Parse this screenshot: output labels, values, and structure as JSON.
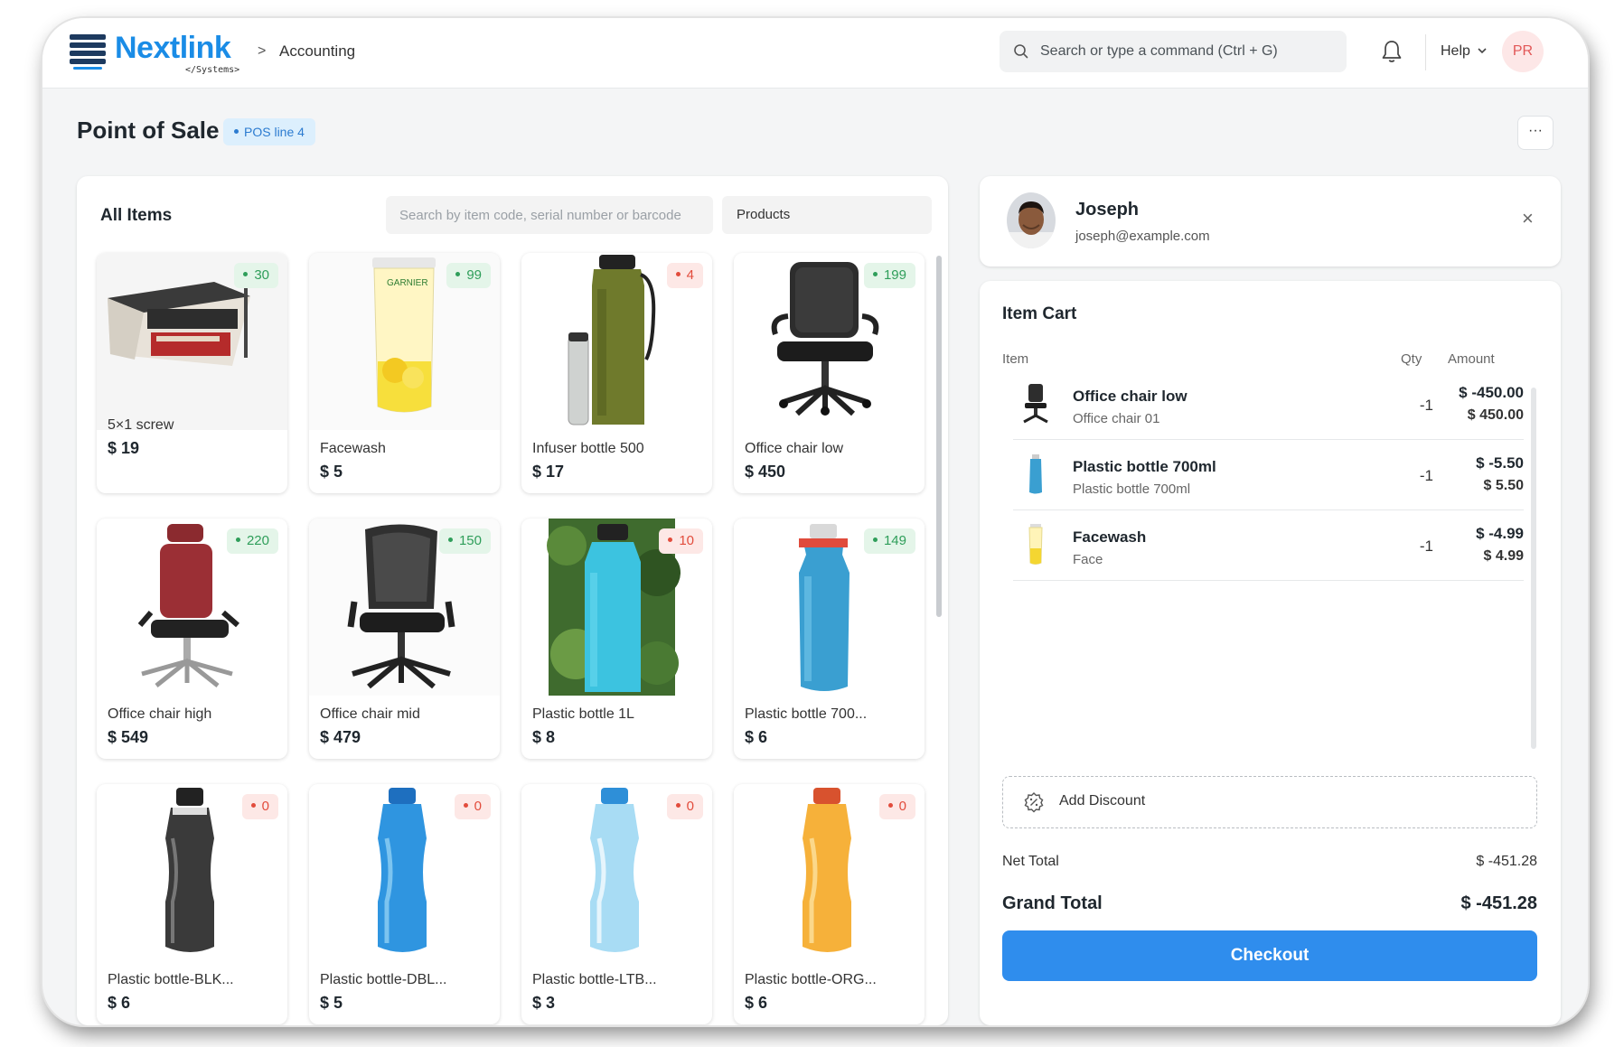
{
  "navbar": {
    "brand": "Nextlink",
    "brand_sub": "</Systems>",
    "breadcrumb_sep": ">",
    "breadcrumb": "Accounting",
    "search_placeholder": "Search or type a command (Ctrl + G)",
    "help": "Help",
    "user_initials": "PR"
  },
  "page": {
    "title": "Point of Sale",
    "status": "POS line 4",
    "more": "···"
  },
  "items": {
    "title": "All Items",
    "search_placeholder": "Search by item code, serial number or barcode",
    "group_filter": "Products",
    "cards": [
      {
        "name": "5×1 screw",
        "price": "$ 19",
        "stock": "30",
        "stock_status": "ok",
        "image": "screw-box"
      },
      {
        "name": "Facewash",
        "price": "$ 5",
        "stock": "99",
        "stock_status": "ok",
        "image": "facewash-tube"
      },
      {
        "name": "Infuser bottle 500",
        "price": "$ 17",
        "stock": "4",
        "stock_status": "low",
        "image": "infuser-bottle"
      },
      {
        "name": "Office chair low",
        "price": "$ 450",
        "stock": "199",
        "stock_status": "ok",
        "image": "office-chair-low"
      },
      {
        "name": "Office chair high",
        "price": "$ 549",
        "stock": "220",
        "stock_status": "ok",
        "image": "office-chair-high"
      },
      {
        "name": "Office chair mid",
        "price": "$ 479",
        "stock": "150",
        "stock_status": "ok",
        "image": "office-chair-mid"
      },
      {
        "name": "Plastic bottle 1L",
        "price": "$ 8",
        "stock": "10",
        "stock_status": "low",
        "image": "plastic-bottle-1l"
      },
      {
        "name": "Plastic bottle 700...",
        "price": "$ 6",
        "stock": "149",
        "stock_status": "ok",
        "image": "plastic-bottle-700"
      },
      {
        "name": "Plastic bottle-BLK...",
        "price": "$ 6",
        "stock": "0",
        "stock_status": "low",
        "image": "bottle-black"
      },
      {
        "name": "Plastic bottle-DBL...",
        "price": "$ 5",
        "stock": "0",
        "stock_status": "low",
        "image": "bottle-dark-blue"
      },
      {
        "name": "Plastic bottle-LTB...",
        "price": "$ 3",
        "stock": "0",
        "stock_status": "low",
        "image": "bottle-light-blue"
      },
      {
        "name": "Plastic bottle-ORG...",
        "price": "$ 6",
        "stock": "0",
        "stock_status": "low",
        "image": "bottle-orange"
      }
    ]
  },
  "customer": {
    "name": "Joseph",
    "email": "joseph@example.com",
    "close": "×"
  },
  "cart": {
    "title": "Item Cart",
    "col_item": "Item",
    "col_qty": "Qty",
    "col_amount": "Amount",
    "rows": [
      {
        "name": "Office chair low",
        "desc": "Office chair 01",
        "qty": "-1",
        "amount": "$ -450.00",
        "rate": "$ 450.00",
        "image": "office-chair-low"
      },
      {
        "name": "Plastic bottle 700ml",
        "desc": "Plastic bottle 700ml",
        "qty": "-1",
        "amount": "$ -5.50",
        "rate": "$ 5.50",
        "image": "plastic-bottle-700"
      },
      {
        "name": "Facewash",
        "desc": "Face",
        "qty": "-1",
        "amount": "$ -4.99",
        "rate": "$ 4.99",
        "image": "facewash-tube"
      }
    ],
    "add_discount": "Add Discount",
    "net_total_label": "Net Total",
    "net_total": "$ -451.28",
    "grand_total_label": "Grand Total",
    "grand_total": "$ -451.28",
    "checkout": "Checkout"
  },
  "colors": {
    "brand": "#1a8ce6",
    "primary": "#2f8ded",
    "stock_ok": "#2f9e5a",
    "stock_low": "#e24c3c"
  }
}
